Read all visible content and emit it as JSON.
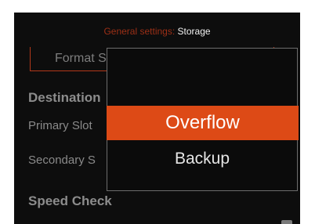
{
  "header": {
    "accent_text": "General settings:",
    "title": "Storage"
  },
  "tabs": {
    "active_label": "Format S"
  },
  "destination": {
    "section_label": "Destination",
    "primary_slot_label": "Primary Slot",
    "secondary_slot_label": "Secondary S"
  },
  "speed_check": {
    "section_label": "Speed Check"
  },
  "dropdown": {
    "options": [
      {
        "label": "Overflow",
        "selected": true
      },
      {
        "label": "Backup",
        "selected": false
      }
    ]
  },
  "colors": {
    "accent": "#dd4a16",
    "background": "#0d0d0d",
    "border": "#6d6d6d"
  }
}
